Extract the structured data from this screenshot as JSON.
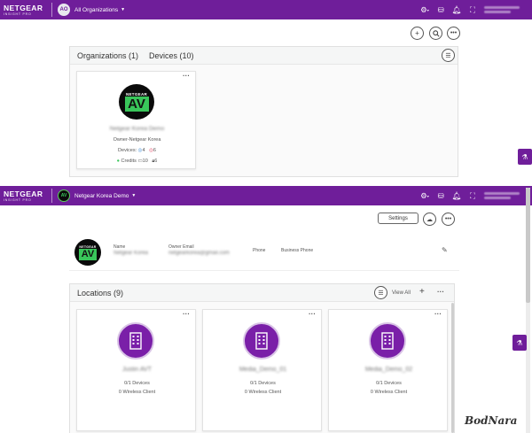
{
  "brand": {
    "name": "NETGEAR",
    "sub": "INSIGHT",
    "badge": "PRO"
  },
  "screen1": {
    "org_avatar": "AO",
    "org_name": "All Organizations",
    "tabs": [
      {
        "label": "Organizations (1)"
      },
      {
        "label": "Devices (10)"
      }
    ],
    "card": {
      "logo_top": "NETGEAR",
      "logo_main": "AV",
      "name": "Netgear Korea Demo",
      "owner": "Owner-Netgear Korea",
      "devices_label": "Devices:",
      "devices_online": "4",
      "devices_offline": "6",
      "credits_label": "Credits",
      "credits_value": "10",
      "users_value": "6"
    }
  },
  "screen2": {
    "org_name": "Netgear Korea Demo",
    "settings_label": "Settings",
    "org_info": {
      "logo_top": "NETGEAR",
      "logo_main": "AV",
      "name_label": "Name",
      "name_value": "Netgear Korea",
      "owner_email_label": "Owner Email",
      "owner_email_value": "netgearkorea@gmail.com",
      "phone_label": "Phone",
      "business_phone_label": "Business Phone"
    },
    "locations_title": "Locations (9)",
    "view_all_label": "View All",
    "locations": [
      {
        "name": "Justin AVT",
        "devices": "0/1 Devices",
        "clients": "0 Wireless Client"
      },
      {
        "name": "Media_Demo_01",
        "devices": "0/1 Devices",
        "clients": "0 Wireless Client"
      },
      {
        "name": "Media_Demo_02",
        "devices": "0/1 Devices",
        "clients": "0 Wireless Client"
      }
    ]
  },
  "watermark": "BodNara",
  "colors": {
    "topbar": "#6f1e9a",
    "accent_green": "#39c65a",
    "location_purple": "#7a1fa8"
  }
}
